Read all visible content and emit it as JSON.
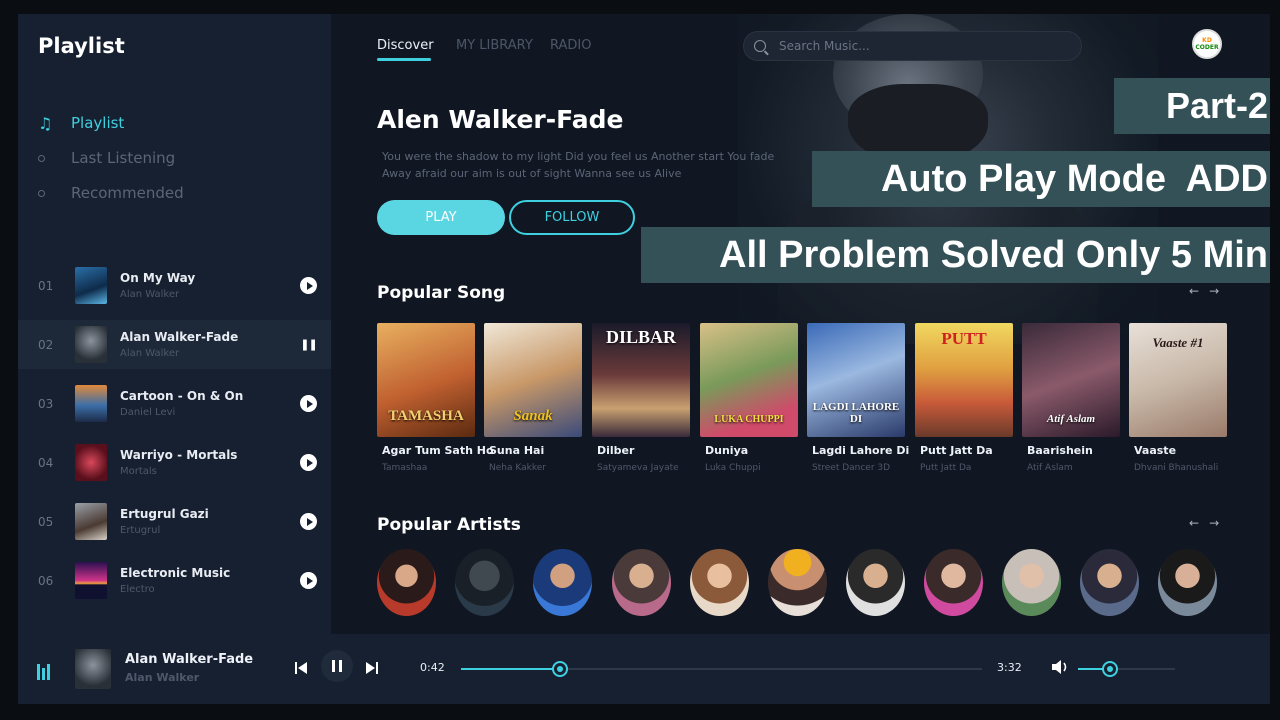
{
  "sidebar": {
    "title": "Playlist",
    "nav": [
      {
        "label": "Playlist",
        "active": true
      },
      {
        "label": "Last Listening",
        "active": false
      },
      {
        "label": "Recommended",
        "active": false
      }
    ],
    "tracks": [
      {
        "num": "01",
        "title": "On My Way",
        "artist": "Alan Walker",
        "state": "play"
      },
      {
        "num": "02",
        "title": "Alan Walker-Fade",
        "artist": "Alan Walker",
        "state": "pause"
      },
      {
        "num": "03",
        "title": "Cartoon - On & On",
        "artist": "Daniel Levi",
        "state": "play"
      },
      {
        "num": "04",
        "title": "Warriyo - Mortals",
        "artist": "Mortals",
        "state": "play"
      },
      {
        "num": "05",
        "title": "Ertugrul Gazi",
        "artist": "Ertugrul",
        "state": "play"
      },
      {
        "num": "06",
        "title": "Electronic Music",
        "artist": "Electro",
        "state": "play"
      }
    ]
  },
  "header": {
    "tabs": [
      {
        "label": "Discover",
        "active": true
      },
      {
        "label": "MY LIBRARY",
        "active": false
      },
      {
        "label": "RADIO",
        "active": false
      }
    ],
    "search_placeholder": "Search Music...",
    "avatar": {
      "line1": "KD",
      "line2": "CODER"
    }
  },
  "hero": {
    "title": "Alen Walker-Fade",
    "description_line1": "You were the shadow to my light Did you feel us Another start You fade",
    "description_line2": "Away afraid our aim is out of sight Wanna see us Alive",
    "play_label": "PLAY",
    "follow_label": "FOLLOW"
  },
  "overlay": {
    "part": "Part-2",
    "line2": "Auto Play Mode  ADD",
    "line3": "All Problem Solved Only 5 Min"
  },
  "popular_songs": {
    "title": "Popular Song",
    "items": [
      {
        "name": "Agar Tum Sath Ho",
        "sub": "Tamashaa",
        "cover_text": "TAMASHA"
      },
      {
        "name": "Suna Hai",
        "sub": "Neha Kakker",
        "cover_text": "Sanak"
      },
      {
        "name": "Dilber",
        "sub": "Satyameva Jayate",
        "cover_text": "DILBAR"
      },
      {
        "name": "Duniya",
        "sub": "Luka Chuppi",
        "cover_text": "LUKA CHUPPI"
      },
      {
        "name": "Lagdi Lahore Di",
        "sub": "Street Dancer 3D",
        "cover_text": "LAGDI LAHORE DI"
      },
      {
        "name": "Putt Jatt Da",
        "sub": "Putt Jatt Da",
        "cover_text": "PUTT"
      },
      {
        "name": "Baarishein",
        "sub": "Atif Aslam",
        "cover_text": "Atif Aslam"
      },
      {
        "name": "Vaaste",
        "sub": "Dhvani Bhanushali",
        "cover_text": "Vaaste #1"
      }
    ]
  },
  "popular_artists": {
    "title": "Popular Artists",
    "count": 11
  },
  "player": {
    "title": "Alan Walker-Fade",
    "artist": "Alan Walker",
    "current_time": "0:42",
    "total_time": "3:32",
    "progress": 0.19,
    "volume": 0.33
  },
  "colors": {
    "accent": "#3fd0e0",
    "background": "#101722",
    "sidebar": "#172030",
    "banner": "#355158"
  }
}
